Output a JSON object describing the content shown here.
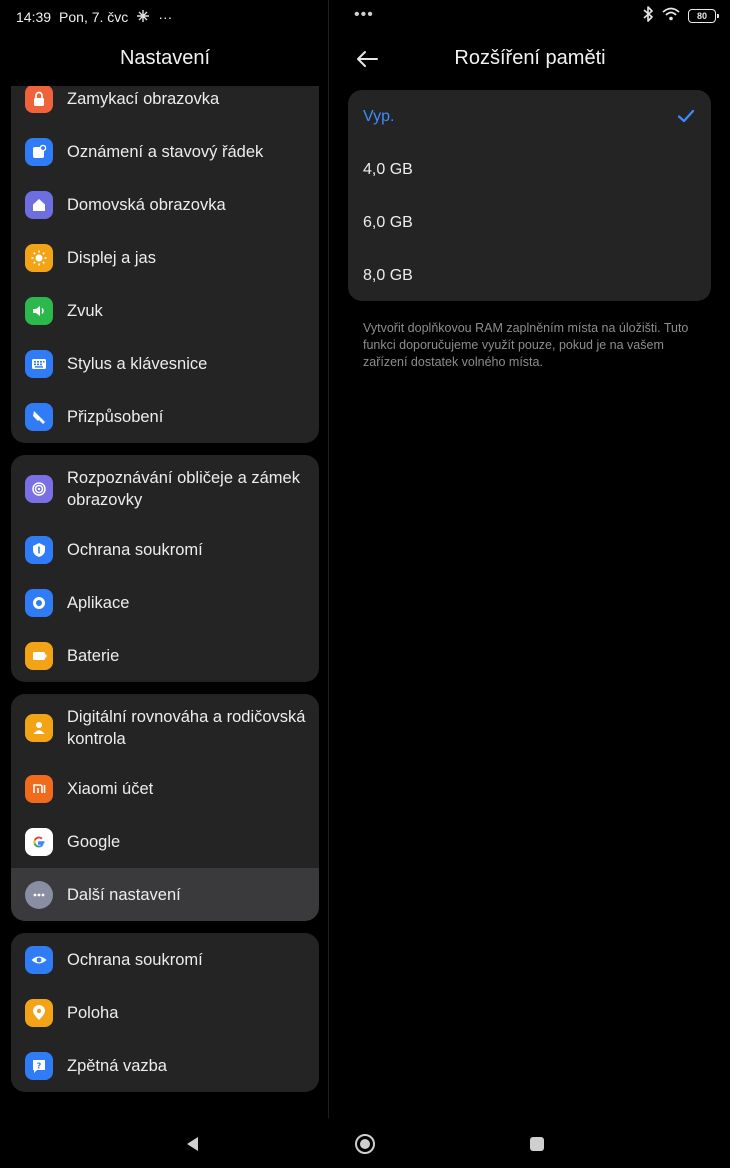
{
  "status": {
    "time": "14:39",
    "date": "Pon, 7. čvc",
    "overflow": "···",
    "dots": "•••",
    "battery": "80",
    "icons": [
      "cellular-data-icon",
      "bluetooth-icon",
      "wifi-icon",
      "battery-icon"
    ]
  },
  "left": {
    "title": "Nastavení",
    "groups": [
      {
        "items": [
          {
            "label": "Zamykací obrazovka",
            "icon": "lock-icon",
            "color": "#f0623a"
          },
          {
            "label": "Oznámení a stavový řádek",
            "icon": "notification-icon",
            "color": "#2f7cf6"
          },
          {
            "label": "Domovská obrazovka",
            "icon": "home-icon",
            "color": "#6d6ee0"
          },
          {
            "label": "Displej a jas",
            "icon": "sun-icon",
            "color": "#f2a416"
          },
          {
            "label": "Zvuk",
            "icon": "speaker-icon",
            "color": "#2db84d"
          },
          {
            "label": "Stylus a klávesnice",
            "icon": "keyboard-icon",
            "color": "#2f7cf6"
          },
          {
            "label": "Přizpůsobení",
            "icon": "brush-icon",
            "color": "#2f7cf6"
          }
        ]
      },
      {
        "items": [
          {
            "label": "Rozpoznávání obličeje a zámek obrazovky",
            "icon": "face-unlock-icon",
            "color": "#7b6fe6"
          },
          {
            "label": "Ochrana soukromí",
            "icon": "privacy-shield-icon",
            "color": "#2f7cf6"
          },
          {
            "label": "Aplikace",
            "icon": "apps-icon",
            "color": "#2f7cf6"
          },
          {
            "label": "Baterie",
            "icon": "battery-settings-icon",
            "color": "#f2a416"
          }
        ]
      },
      {
        "items": [
          {
            "label": "Digitální rovnováha a rodičovská kontrola",
            "icon": "parental-icon",
            "color": "#f2a416"
          },
          {
            "label": "Xiaomi účet",
            "icon": "xiaomi-logo-icon",
            "color": "#f26a1c"
          },
          {
            "label": "Google",
            "icon": "google-logo-icon",
            "color": "#ffffff"
          },
          {
            "label": "Další nastavení",
            "icon": "more-dots-icon",
            "color": "#8a8ea3"
          }
        ]
      },
      {
        "items": [
          {
            "label": "Ochrana soukromí",
            "icon": "eye-icon",
            "color": "#2f7cf6"
          },
          {
            "label": "Poloha",
            "icon": "location-pin-icon",
            "color": "#f2a416"
          },
          {
            "label": "Zpětná vazba",
            "icon": "feedback-icon",
            "color": "#2f7cf6"
          }
        ]
      }
    ]
  },
  "right": {
    "title": "Rozšíření paměti",
    "options": [
      {
        "label": "Vyp.",
        "selected": true
      },
      {
        "label": "4,0 GB",
        "selected": false
      },
      {
        "label": "6,0 GB",
        "selected": false
      },
      {
        "label": "8,0 GB",
        "selected": false
      }
    ],
    "hint": "Vytvořit doplňkovou RAM zaplněním místa na úložišti. Tuto funkci doporučujeme využít pouze, pokud je na vašem zařízení dostatek volného místa.",
    "accent": "#3d8cff"
  },
  "nav": {
    "buttons": [
      "back-triangle-icon",
      "home-circle-icon",
      "recents-square-icon"
    ]
  }
}
